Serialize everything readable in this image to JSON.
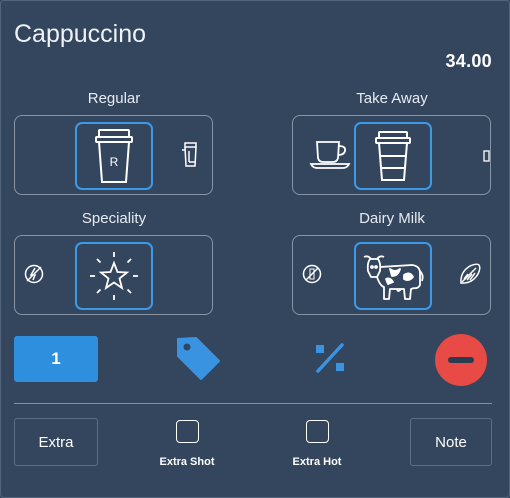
{
  "product": {
    "name": "Cappuccino",
    "price": "34.00"
  },
  "groups": {
    "size": {
      "label": "Regular",
      "selected_icon": "takeaway-cup-r-icon",
      "side_icon": "tall-cup-icon",
      "selected_letter": "R"
    },
    "serving": {
      "label": "Take Away",
      "left_icon": "cup-and-saucer-icon",
      "selected_icon": "takeaway-cup-icon",
      "right_icon": "small-cup-icon"
    },
    "speciality": {
      "label": "Speciality",
      "left_icon": "no-speciality-icon",
      "selected_icon": "star-burst-icon"
    },
    "milk": {
      "label": "Dairy Milk",
      "left_icon": "no-milk-icon",
      "selected_icon": "cow-icon",
      "right_icon": "almond-icon"
    }
  },
  "actions": {
    "quantity": "1",
    "tag_icon": "price-tag-icon",
    "discount_icon": "percent-icon",
    "remove_icon": "remove-icon"
  },
  "footer": {
    "extra_label": "Extra",
    "extra_shot_label": "Extra Shot",
    "extra_hot_label": "Extra Hot",
    "note_label": "Note"
  },
  "colors": {
    "background": "#34465e",
    "accent": "#2f8fdf",
    "danger": "#e84a45"
  }
}
